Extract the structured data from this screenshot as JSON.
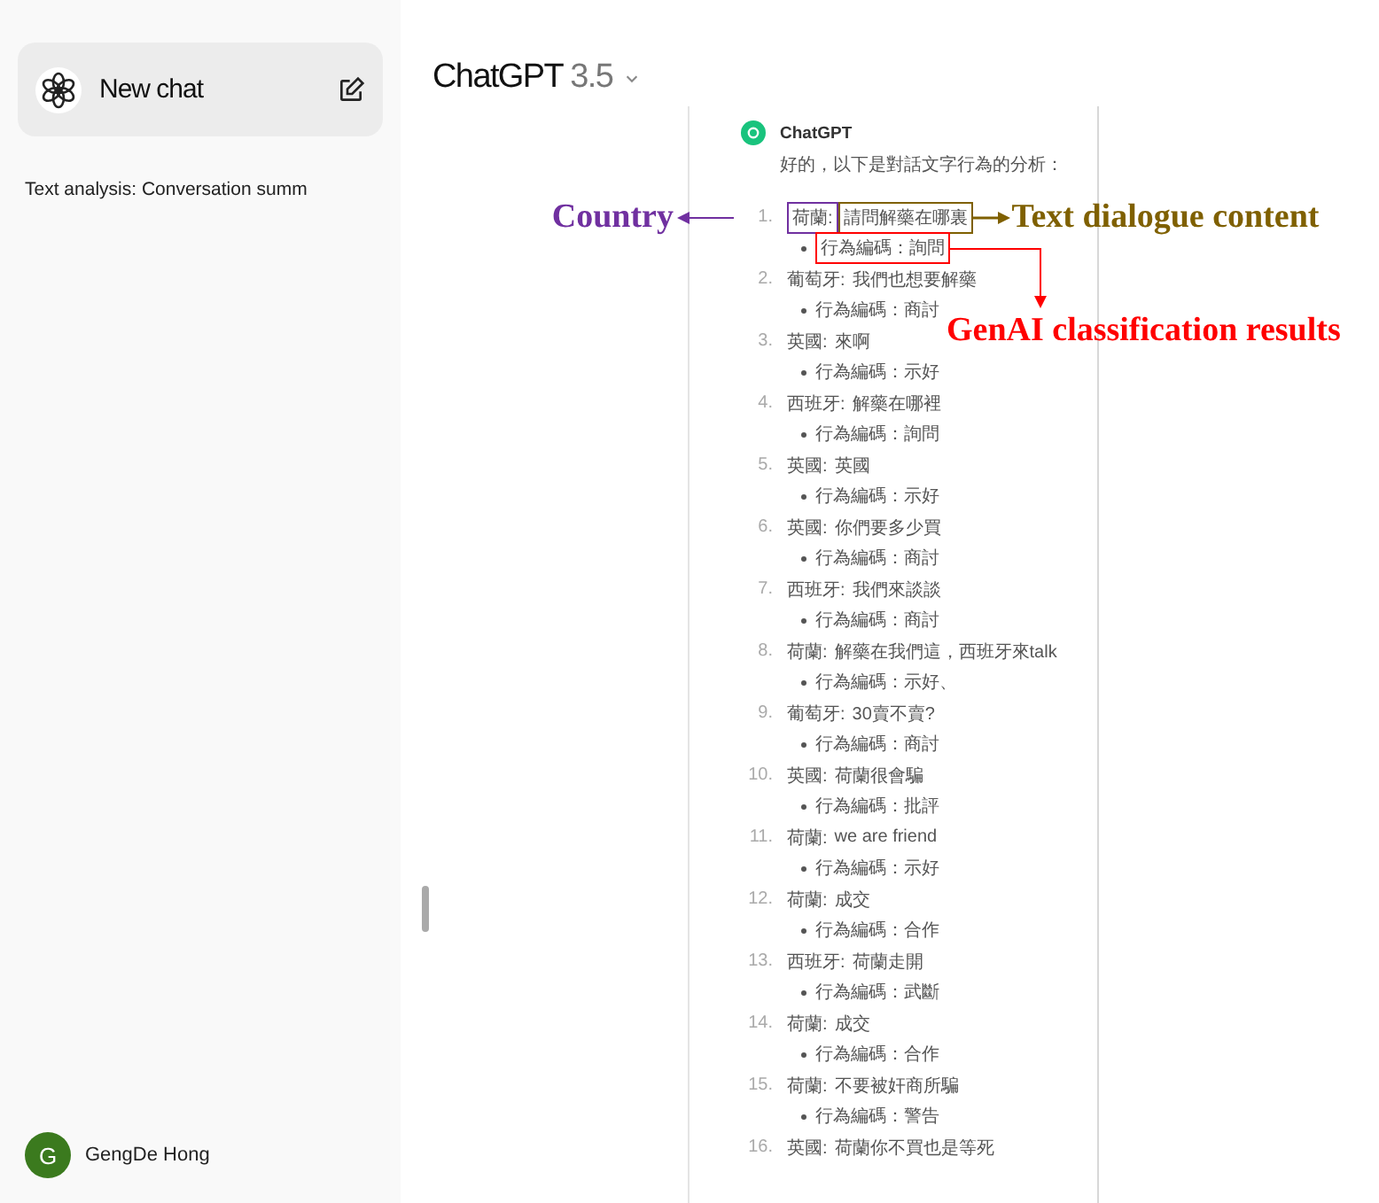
{
  "sidebar": {
    "new_chat": "New chat",
    "history": [
      {
        "title": "Text analysis: Conversation summ"
      }
    ],
    "user": {
      "initial": "G",
      "name": "GengDe Hong"
    }
  },
  "header": {
    "title": "ChatGPT",
    "version": "3.5"
  },
  "message": {
    "author": "ChatGPT",
    "intro": "好的，以下是對話文字行為的分析：",
    "items": [
      {
        "number": "1.",
        "country": "荷蘭:",
        "text": "請問解藥在哪裏",
        "code": "行為編碼：詢問"
      },
      {
        "number": "2.",
        "country": "葡萄牙:",
        "text": "我們也想要解藥",
        "code": "行為編碼：商討"
      },
      {
        "number": "3.",
        "country": "英國:",
        "text": "來啊",
        "code": "行為編碼：示好"
      },
      {
        "number": "4.",
        "country": "西班牙:",
        "text": "解藥在哪裡",
        "code": "行為編碼：詢問"
      },
      {
        "number": "5.",
        "country": "英國:",
        "text": "英國",
        "code": "行為編碼：示好"
      },
      {
        "number": "6.",
        "country": "英國:",
        "text": "你們要多少買",
        "code": "行為編碼：商討"
      },
      {
        "number": "7.",
        "country": "西班牙:",
        "text": "我們來談談",
        "code": "行為編碼：商討"
      },
      {
        "number": "8.",
        "country": "荷蘭:",
        "text": "解藥在我們這，西班牙來talk",
        "code": "行為編碼：示好、"
      },
      {
        "number": "9.",
        "country": "葡萄牙:",
        "text": "30賣不賣?",
        "code": "行為編碼：商討"
      },
      {
        "number": "10.",
        "country": "英國:",
        "text": "荷蘭很會騙",
        "code": "行為編碼：批評"
      },
      {
        "number": "11.",
        "country": "荷蘭:",
        "text": "we are friend",
        "code": "行為編碼：示好"
      },
      {
        "number": "12.",
        "country": "荷蘭:",
        "text": "成交",
        "code": "行為編碼：合作"
      },
      {
        "number": "13.",
        "country": "西班牙:",
        "text": "荷蘭走開",
        "code": "行為編碼：武斷"
      },
      {
        "number": "14.",
        "country": "荷蘭:",
        "text": "成交",
        "code": "行為編碼：合作"
      },
      {
        "number": "15.",
        "country": "荷蘭:",
        "text": "不要被奸商所騙",
        "code": "行為編碼：警告"
      },
      {
        "number": "16.",
        "country": "英國:",
        "text": "荷蘭你不買也是等死"
      }
    ]
  },
  "annotations": [
    {
      "kind": "country",
      "label": "Country",
      "color": "#7030a0"
    },
    {
      "kind": "content",
      "label": "Text dialogue content",
      "color": "#7f6000"
    },
    {
      "kind": "code",
      "label": "GenAI classification results",
      "color": "#ff0000"
    }
  ]
}
